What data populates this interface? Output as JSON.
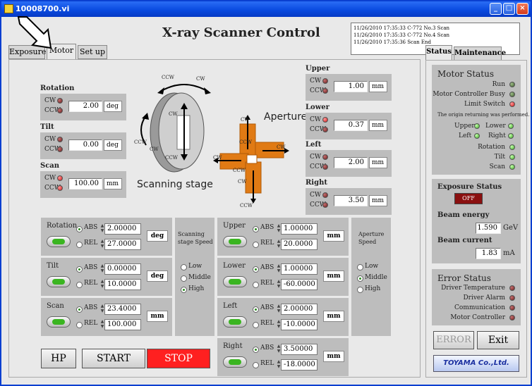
{
  "window": {
    "title": "10008700.vi",
    "app_title": "X-ray Scanner Control"
  },
  "tabs_left": [
    "Exposure",
    "Motor",
    "Set up"
  ],
  "tabs_right": [
    "Status",
    "Maintenance"
  ],
  "log_lines": [
    "11/26/2010 17:35:33 C-772 No.3 Scan",
    "11/26/2010 17:35:33 C-772 No.4 Scan",
    "11/26/2010 17:35:36 Scan End"
  ],
  "stage": {
    "rotation": {
      "label": "Rotation",
      "cw": "CW",
      "ccw": "CCW",
      "value": "2.00",
      "unit": "deg"
    },
    "tilt": {
      "label": "Tilt",
      "cw": "CW",
      "ccw": "CCW",
      "value": "0.00",
      "unit": "deg"
    },
    "scan": {
      "label": "Scan",
      "cw": "CW",
      "ccw": "CCW",
      "value": "100.00",
      "unit": "mm"
    }
  },
  "diagram": {
    "stage_caption": "Scanning stage",
    "aperture_caption": "Aperture",
    "cw": "CW",
    "ccw": "CCW"
  },
  "aperture": {
    "upper": {
      "label": "Upper",
      "value": "1.00",
      "unit": "mm"
    },
    "lower": {
      "label": "Lower",
      "value": "0.37",
      "unit": "mm"
    },
    "left": {
      "label": "Left",
      "value": "2.00",
      "unit": "mm"
    },
    "right": {
      "label": "Right",
      "value": "3.50",
      "unit": "mm"
    }
  },
  "motion": {
    "abs": "ABS",
    "rel": "REL",
    "unit_deg": "deg",
    "unit_mm": "mm",
    "rotation": {
      "label": "Rotation",
      "abs": "2.00000",
      "rel": "27.0000"
    },
    "tilt": {
      "label": "Tilt",
      "abs": "0.00000",
      "rel": "10.0000"
    },
    "scan": {
      "label": "Scan",
      "abs": "23.4000",
      "rel": "100.000"
    },
    "upper": {
      "label": "Upper",
      "abs": "1.00000",
      "rel": "20.0000"
    },
    "lower": {
      "label": "Lower",
      "abs": "1.00000",
      "rel": "-60.0000"
    },
    "left": {
      "label": "Left",
      "abs": "2.00000",
      "rel": "-10.0000"
    },
    "right": {
      "label": "Right",
      "abs": "3.50000",
      "rel": "-18.0000"
    }
  },
  "speed_stage": {
    "title": "Scanning stage Speed",
    "low": "Low",
    "middle": "Middle",
    "high": "High",
    "selected": "High"
  },
  "speed_aperture": {
    "title": "Aperture Speed",
    "low": "Low",
    "middle": "Middle",
    "high": "High",
    "selected": "Middle"
  },
  "buttons": {
    "hp": "HP",
    "start": "START",
    "stop": "STOP",
    "error": "ERROR",
    "exit": "Exit",
    "logo": "TOYAMA Co.,Ltd."
  },
  "motor_status": {
    "title": "Motor Status",
    "run": "Run",
    "busy": "Motor Controller Busy",
    "limit": "Limit Switch",
    "message": "The origin returning was performed.",
    "upper": "Upper",
    "lower": "Lower",
    "left": "Left",
    "right": "Right",
    "rotation": "Rotation",
    "tilt": "Tilt",
    "scan": "Scan"
  },
  "exposure_status": {
    "title": "Exposure Status",
    "state": "OFF",
    "energy_label": "Beam energy",
    "energy_value": "1.590",
    "energy_unit": "GeV",
    "current_label": "Beam current",
    "current_value": "1.83",
    "current_unit": "mA"
  },
  "error_status": {
    "title": "Error Status",
    "driver_temp": "Driver Temperature",
    "driver_alarm": "Driver Alarm",
    "communication": "Communication",
    "motor_controller": "Motor Controller"
  }
}
